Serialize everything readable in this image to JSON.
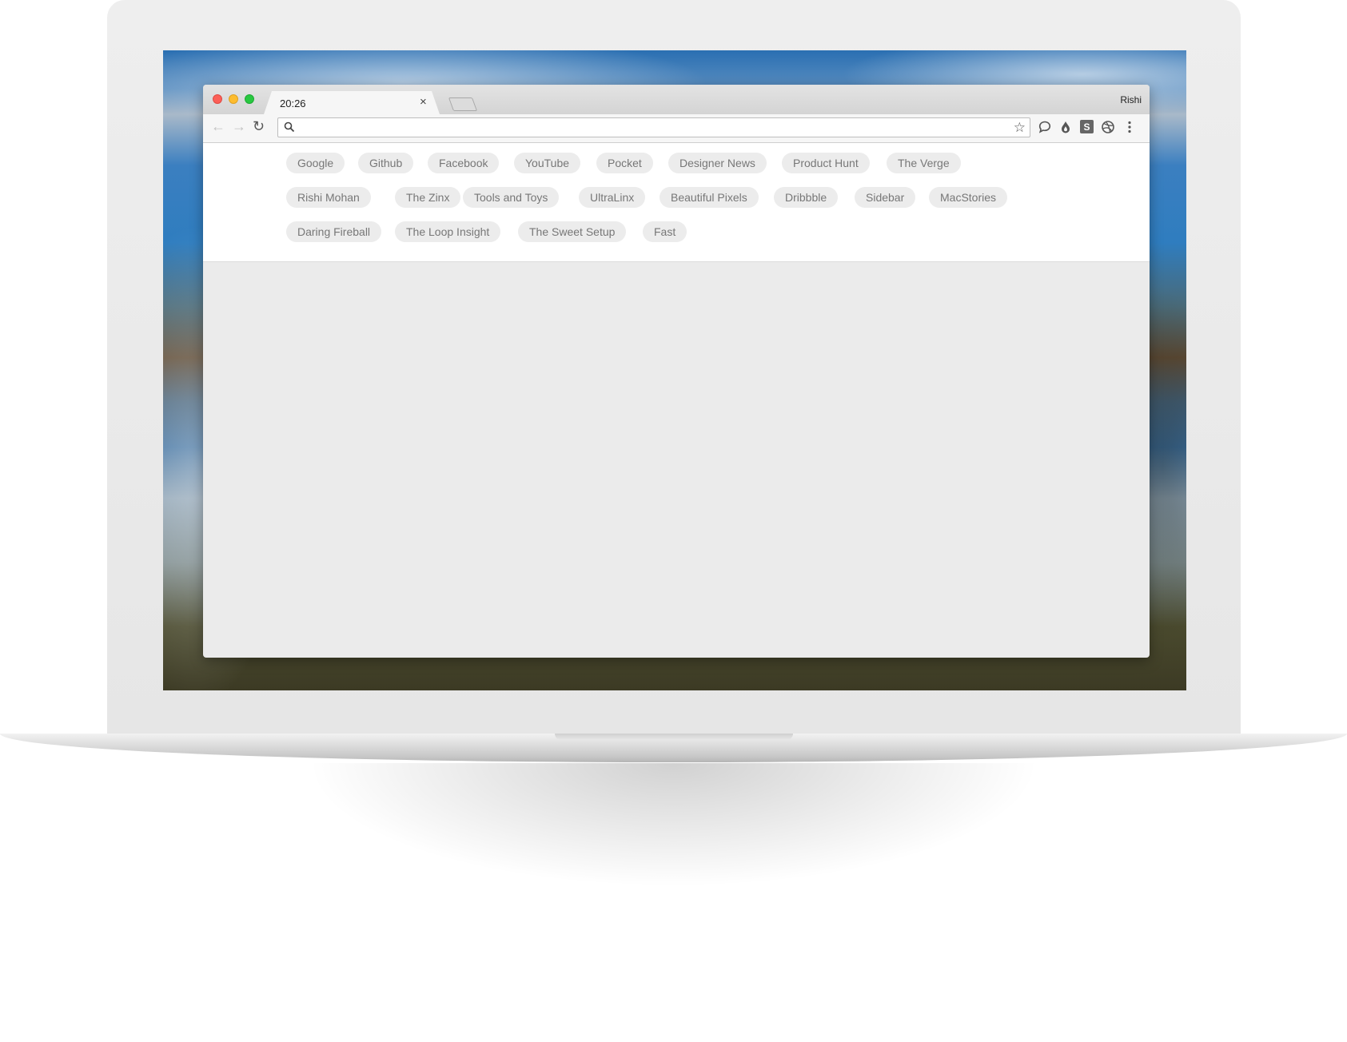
{
  "tab": {
    "title": "20:26",
    "close": "×"
  },
  "window": {
    "profile_name": "Rishi"
  },
  "toolbar": {
    "back": "←",
    "forward": "→",
    "reload": "↻",
    "omnibox_value": "",
    "extensions": [
      "chat-bubble-icon",
      "drop-icon",
      "s-extension-icon",
      "dribbble-icon",
      "more-menu-icon"
    ],
    "s_extension_label": "S"
  },
  "bookmarks": {
    "row1": [
      "Google",
      "Github",
      "Facebook",
      "YouTube",
      "Pocket",
      "Designer News",
      "Product Hunt",
      "The Verge"
    ],
    "row2": [
      "Rishi Mohan",
      "The Zinx",
      "Tools and Toys",
      "UltraLinx",
      "Beautiful Pixels",
      "Dribbble",
      "Sidebar",
      "MacStories"
    ],
    "row3": [
      "Daring Fireball",
      "The Loop Insight",
      "The Sweet Setup",
      "Fast"
    ]
  },
  "colors": {
    "chip_bg": "#ececec",
    "chip_text": "#777777",
    "close_red": "#fc5f57",
    "minimize_yellow": "#fdbc2e",
    "zoom_green": "#28c840"
  }
}
